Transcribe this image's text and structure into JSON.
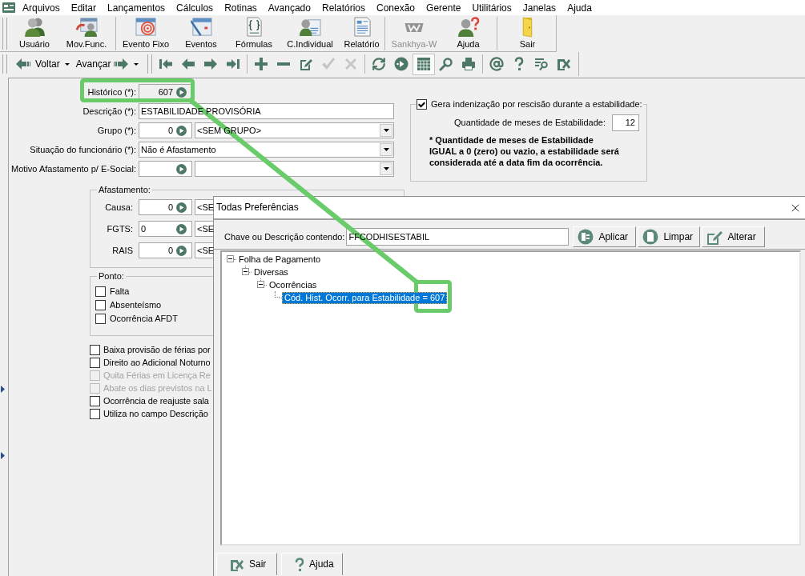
{
  "menu": [
    "Arquivos",
    "Editar",
    "Lançamentos",
    "Cálculos",
    "Rotinas",
    "Avançado",
    "Relatórios",
    "Conexão",
    "Gerente",
    "Utilitários",
    "Janelas",
    "Ajuda"
  ],
  "toolbar": {
    "groups": [
      [
        {
          "label": "Usuário",
          "disabled": false
        },
        {
          "label": "Mov.Func.",
          "disabled": false
        }
      ],
      [
        {
          "label": "Evento Fixo",
          "disabled": false
        },
        {
          "label": "Eventos",
          "disabled": false
        },
        {
          "label": "Fórmulas",
          "disabled": false
        },
        {
          "label": "C.Individual",
          "disabled": false
        },
        {
          "label": "Relatório",
          "disabled": false
        }
      ],
      [
        {
          "label": "Sankhya-W",
          "disabled": true
        },
        {
          "label": "Ajuda",
          "disabled": false
        }
      ],
      [
        {
          "label": "Sair",
          "disabled": false
        }
      ]
    ]
  },
  "nav_toolbar": {
    "back": "Voltar",
    "forward": "Avançar",
    "icon_groups": [
      [
        {
          "disabled": false,
          "pressed": false
        },
        {
          "disabled": false,
          "pressed": false
        },
        {
          "disabled": false,
          "pressed": false
        },
        {
          "disabled": false,
          "pressed": false
        }
      ],
      [
        {
          "disabled": false,
          "pressed": false
        },
        {
          "disabled": false,
          "pressed": false
        },
        {
          "disabled": false,
          "pressed": false
        },
        {
          "disabled": true,
          "pressed": false
        },
        {
          "disabled": true,
          "pressed": false
        }
      ],
      [
        {
          "disabled": false,
          "pressed": false
        },
        {
          "disabled": false,
          "pressed": false
        },
        {
          "disabled": false,
          "pressed": true
        },
        {
          "disabled": false,
          "pressed": false
        },
        {
          "disabled": false,
          "pressed": false
        }
      ],
      [
        {
          "disabled": false,
          "pressed": false
        },
        {
          "disabled": false,
          "pressed": false
        },
        {
          "disabled": false,
          "pressed": false
        },
        {
          "disabled": false,
          "pressed": false
        }
      ]
    ]
  },
  "form": {
    "fields": [
      {
        "kind": "lookup",
        "label": "Histórico (*):",
        "code": "607",
        "readonly": true
      },
      {
        "kind": "text",
        "label": "Descrição (*):",
        "value": "ESTABILIDADE PROVISÓRIA",
        "readonly": false
      },
      {
        "kind": "lookup_combo",
        "label": "Grupo (*):",
        "code": "0",
        "value": "<SEM GRUPO>",
        "readonly": false
      },
      {
        "kind": "combo",
        "label": "Situação do funcionário (*):",
        "value": "Não é Afastamento",
        "readonly": false
      },
      {
        "kind": "lookup_combo",
        "label": "Motivo Afastamento p/ E-Social:",
        "readonly": false
      }
    ],
    "absence": {
      "legend": "Afastamento:",
      "rows": [
        {
          "label": "Causa:",
          "kind": "numeric",
          "code": "0",
          "value": "<SE"
        },
        {
          "label": "FGTS:",
          "kind": "text",
          "code": "0",
          "value": "<SE"
        },
        {
          "label": "RAIS",
          "kind": "numeric",
          "code": "0",
          "value": "<SE"
        }
      ]
    },
    "ponto": {
      "legend": "Ponto:",
      "items": [
        {
          "label": "Falta",
          "checked": false
        },
        {
          "label": "Absenteísmo",
          "checked": false
        },
        {
          "label": "Ocorrência AFDT",
          "checked": false
        }
      ]
    },
    "options": [
      {
        "label": "Baixa provisão de férias por",
        "checked": false,
        "disabled": false
      },
      {
        "label": "Direito ao Adicional Noturno",
        "checked": false,
        "disabled": false
      },
      {
        "label": "Quita Férias em Licença Re",
        "checked": false,
        "disabled": true
      },
      {
        "label": "Abate os dias previstos na L",
        "checked": false,
        "disabled": true
      },
      {
        "label": "Ocorrência de reajuste sala",
        "checked": false,
        "disabled": false
      },
      {
        "label": "Utiliza no campo Descrição",
        "checked": false,
        "disabled": false
      }
    ]
  },
  "stability": {
    "label": "Gera indenização por rescisão durante a estabilidade:",
    "checked": true,
    "months_label": "Quantidade de meses de Estabilidade:",
    "months": "12",
    "note_lines": [
      "* Quantidade de meses de Estabilidade",
      "IGUAL a 0 (zero) ou vazio, a estabilidade será",
      "considerada até a data fim da ocorrência."
    ]
  },
  "dialog": {
    "title": "Todas Preferências",
    "search_label": "Chave ou Descrição contendo:",
    "search_value": "FFCODHISESTABIL",
    "buttons": [
      "Aplicar",
      "Limpar",
      "Alterar"
    ],
    "tree": [
      {
        "label": "Folha de Pagamento",
        "expanded": true,
        "selected": false,
        "children": [
          {
            "label": "Diversas",
            "expanded": true,
            "selected": false,
            "children": [
              {
                "label": "Ocorrências",
                "expanded": true,
                "selected": false,
                "children": [
                  {
                    "label": "Cód. Hist. Ocorr. para Estabilidade = 607",
                    "selected": true
                  }
                ]
              }
            ]
          }
        ]
      }
    ],
    "footer_buttons": [
      "Sair",
      "Ajuda"
    ]
  }
}
